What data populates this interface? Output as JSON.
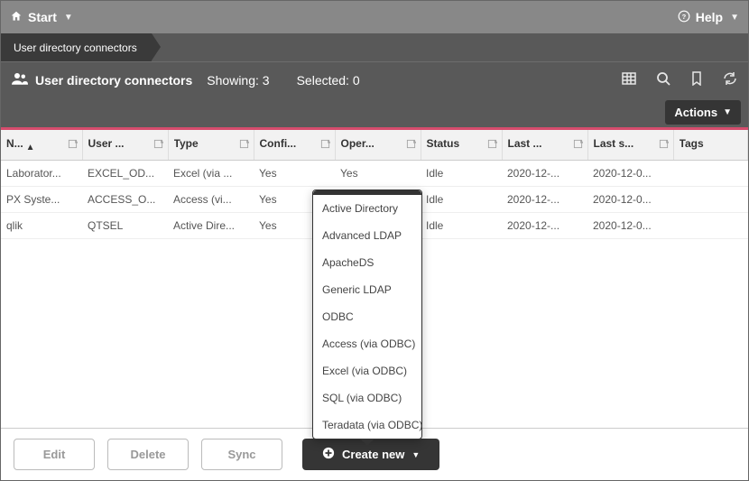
{
  "topbar": {
    "start_label": "Start",
    "help_label": "Help"
  },
  "crumb": {
    "label": "User directory connectors"
  },
  "toolbar": {
    "title": "User directory connectors",
    "showing_label": "Showing:",
    "showing_count": "3",
    "selected_label": "Selected:",
    "selected_count": "0"
  },
  "actions_btn": "Actions",
  "headers": {
    "name": "N...",
    "user": "User ...",
    "type": "Type",
    "configured": "Confi...",
    "operational": "Oper...",
    "status": "Status",
    "last": "Last ...",
    "last_s": "Last s...",
    "tags": "Tags"
  },
  "rows": [
    {
      "name": "Laborator...",
      "user": "EXCEL_OD...",
      "type": "Excel (via ...",
      "conf": "Yes",
      "oper": "Yes",
      "status": "Idle",
      "last": "2020-12-...",
      "lasts": "2020-12-0...",
      "tags": ""
    },
    {
      "name": "PX Syste...",
      "user": "ACCESS_O...",
      "type": "Access (vi...",
      "conf": "Yes",
      "oper": "",
      "status": "Idle",
      "last": "2020-12-...",
      "lasts": "2020-12-0...",
      "tags": ""
    },
    {
      "name": "qlik",
      "user": "QTSEL",
      "type": "Active Dire...",
      "conf": "Yes",
      "oper": "",
      "status": "Idle",
      "last": "2020-12-...",
      "lasts": "2020-12-0...",
      "tags": ""
    }
  ],
  "dropdown_items": [
    "Active Directory",
    "Advanced LDAP",
    "ApacheDS",
    "Generic LDAP",
    "ODBC",
    "Access (via ODBC)",
    "Excel (via ODBC)",
    "SQL (via ODBC)",
    "Teradata (via ODBC)"
  ],
  "bottom": {
    "edit": "Edit",
    "delete": "Delete",
    "sync": "Sync",
    "create_new": "Create new"
  }
}
